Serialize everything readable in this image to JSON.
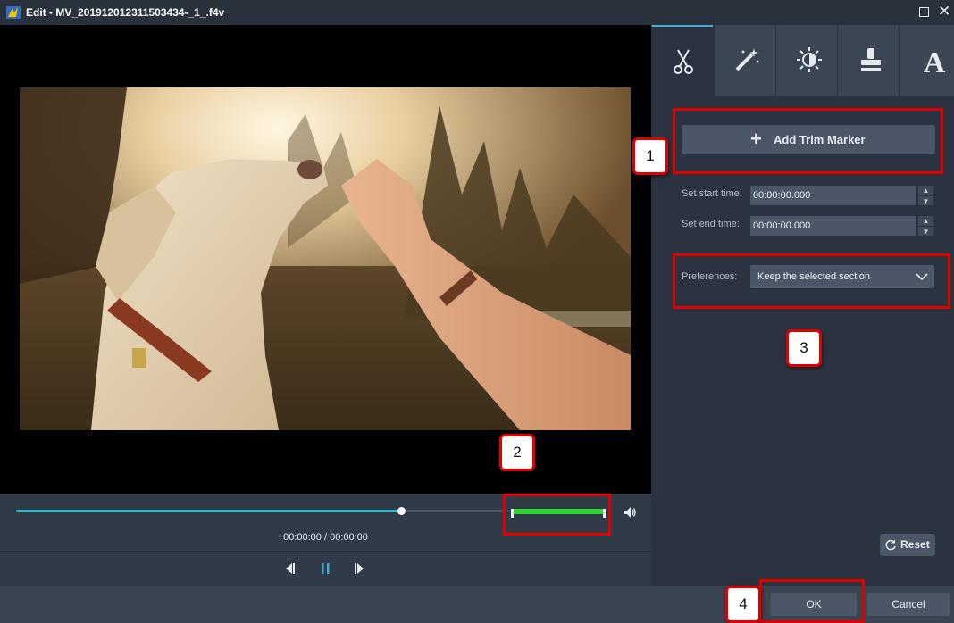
{
  "window": {
    "title": "Edit - MV_201912012311503434-_1_.f4v",
    "maximize_symbol": "",
    "close_symbol": "✕"
  },
  "player": {
    "timecode": "00:00:00 / 00:00:00",
    "progress_fraction": 0.79
  },
  "tabs": [
    {
      "name": "trim",
      "icon": "scissors-icon",
      "active": true
    },
    {
      "name": "effects",
      "icon": "magic-wand-icon",
      "active": false
    },
    {
      "name": "adjust",
      "icon": "brightness-icon",
      "active": false
    },
    {
      "name": "watermark",
      "icon": "stamp-icon",
      "active": false
    },
    {
      "name": "text",
      "icon": "text-A-icon",
      "active": false
    }
  ],
  "trim_panel": {
    "add_marker_label": "Add Trim Marker",
    "start_label": "Set start time:",
    "start_value": "00:00:00.000",
    "end_label": "Set end time:",
    "end_value": "00:00:00.000",
    "preferences_label": "Preferences:",
    "preferences_value": "Keep the selected section",
    "reset_label": "Reset"
  },
  "footer": {
    "ok_label": "OK",
    "cancel_label": "Cancel"
  },
  "annotations": {
    "badge_1": "1",
    "badge_2": "2",
    "badge_3": "3",
    "badge_4": "4"
  },
  "colors": {
    "accent": "#2ab7c5",
    "trim_green": "#2fd52f",
    "annotation_red": "#e00000"
  }
}
